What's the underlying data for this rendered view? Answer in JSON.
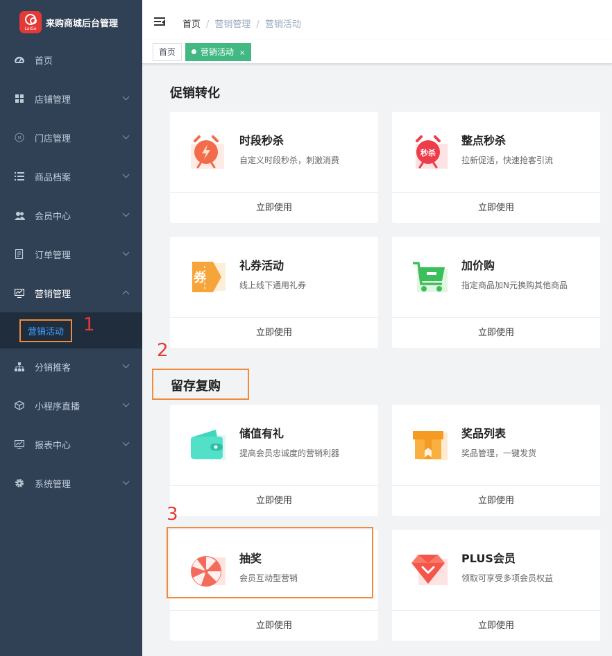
{
  "app": {
    "title": "来购商城后台管理",
    "logo_text": "LaiGo",
    "accent": "#42b983",
    "sidebar_bg": "#304156"
  },
  "sidebar": {
    "items": [
      {
        "label": "首页",
        "icon": "dashboard-icon"
      },
      {
        "label": "店铺管理",
        "icon": "grid-icon"
      },
      {
        "label": "门店管理",
        "icon": "store-icon"
      },
      {
        "label": "商品档案",
        "icon": "list-icon"
      },
      {
        "label": "会员中心",
        "icon": "users-icon"
      },
      {
        "label": "订单管理",
        "icon": "order-icon"
      },
      {
        "label": "营销管理",
        "icon": "monitor-icon"
      },
      {
        "label": "分销推客",
        "icon": "sitemap-icon"
      },
      {
        "label": "小程序直播",
        "icon": "cube-icon"
      },
      {
        "label": "报表中心",
        "icon": "chart-monitor-icon"
      },
      {
        "label": "系统管理",
        "icon": "gear-icon"
      }
    ],
    "active_sub": "营销活动"
  },
  "breadcrumb": [
    "首页",
    "营销管理",
    "营销活动"
  ],
  "tags": [
    {
      "label": "首页"
    },
    {
      "label": "营销活动",
      "close": "×"
    }
  ],
  "sections": [
    {
      "title": "促销转化",
      "cards": [
        {
          "title": "时段秒杀",
          "desc": "自定义时段秒杀，刺激消费",
          "action": "立即使用",
          "icon": "alarm-lightning-icon"
        },
        {
          "title": "整点秒杀",
          "desc": "拉新促活，快速抢客引流",
          "action": "立即使用",
          "icon": "alarm-seckill-icon",
          "icon_text": "秒杀"
        },
        {
          "title": "礼券活动",
          "desc": "线上线下通用礼券",
          "action": "立即使用",
          "icon": "coupon-icon",
          "icon_text": "券"
        },
        {
          "title": "加价购",
          "desc": "指定商品加N元换购其他商品",
          "action": "立即使用",
          "icon": "cart-icon"
        }
      ]
    },
    {
      "title": "留存复购",
      "cards": [
        {
          "title": "储值有礼",
          "desc": "提高会员忠诚度的营销利器",
          "action": "立即使用",
          "icon": "wallet-icon"
        },
        {
          "title": "奖品列表",
          "desc": "奖品管理，一键发货",
          "action": "立即使用",
          "icon": "gift-box-icon"
        },
        {
          "title": "抽奖",
          "desc": "会员互动型营销",
          "action": "立即使用",
          "icon": "lottery-wheel-icon"
        },
        {
          "title": "PLUS会员",
          "desc": "领取可享受多项会员权益",
          "action": "立即使用",
          "icon": "diamond-icon"
        }
      ]
    }
  ],
  "annotations": [
    "1",
    "2",
    "3"
  ]
}
